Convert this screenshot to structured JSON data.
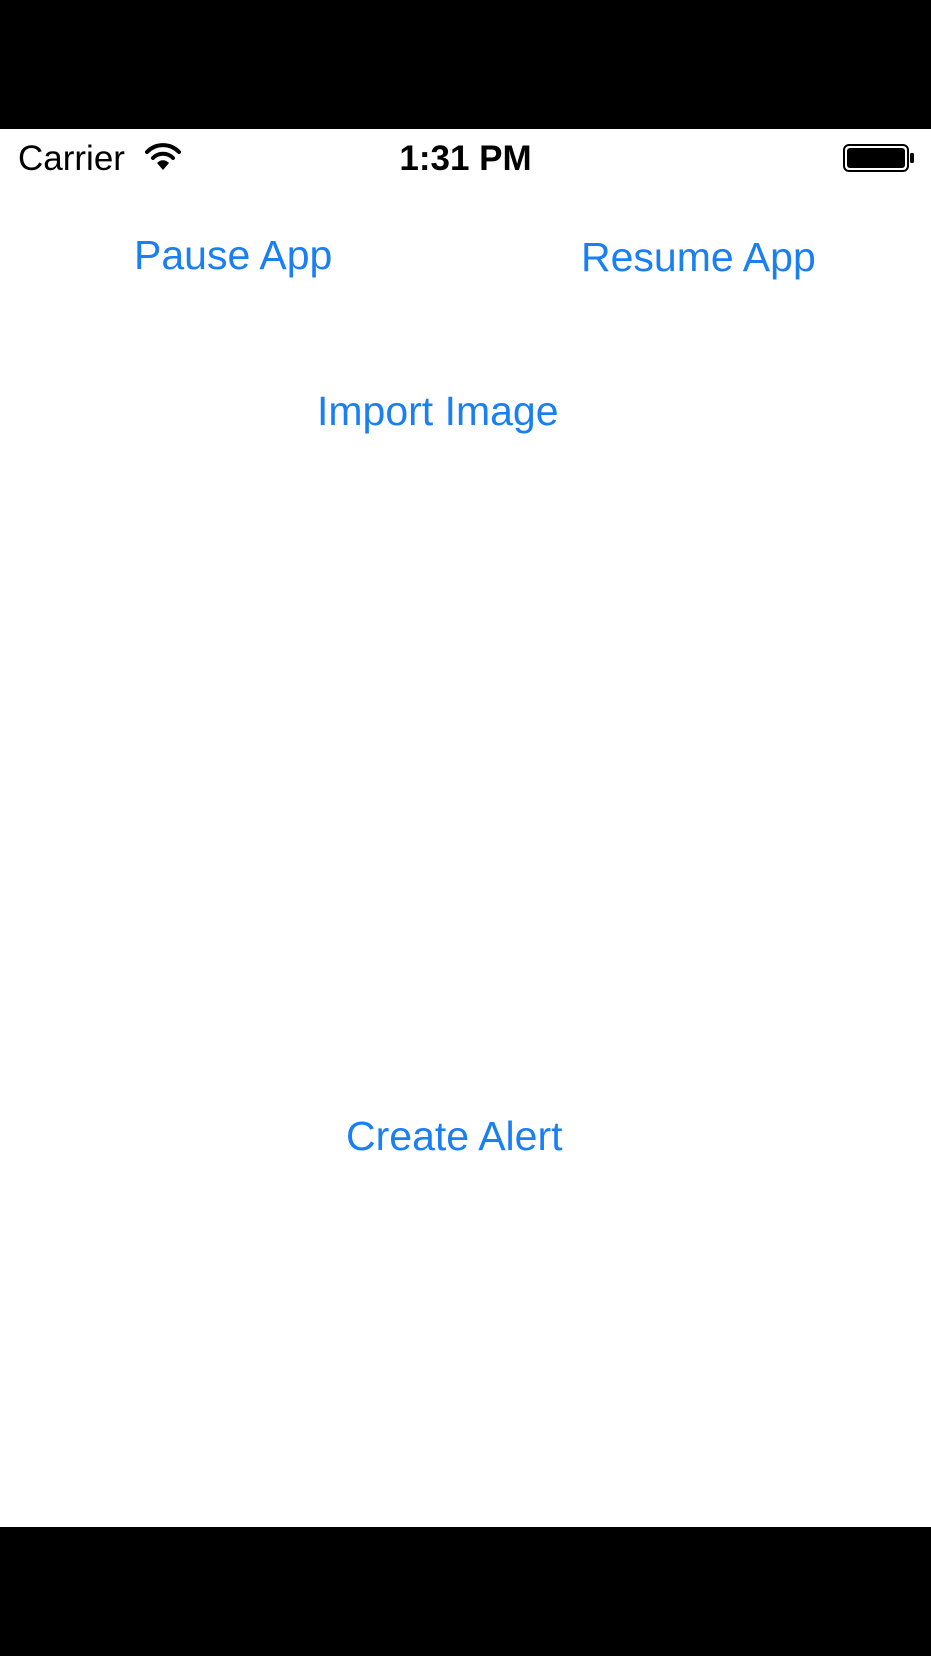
{
  "status_bar": {
    "carrier": "Carrier",
    "time": "1:31 PM",
    "wifi_icon": "wifi-icon",
    "battery_icon": "battery-icon",
    "battery_level": 1.0
  },
  "buttons": {
    "pause": "Pause App",
    "resume": "Resume App",
    "import_image": "Import Image",
    "create_alert": "Create Alert"
  },
  "colors": {
    "accent": "#1a7ff2",
    "background": "#ffffff",
    "letterbox": "#000000"
  }
}
